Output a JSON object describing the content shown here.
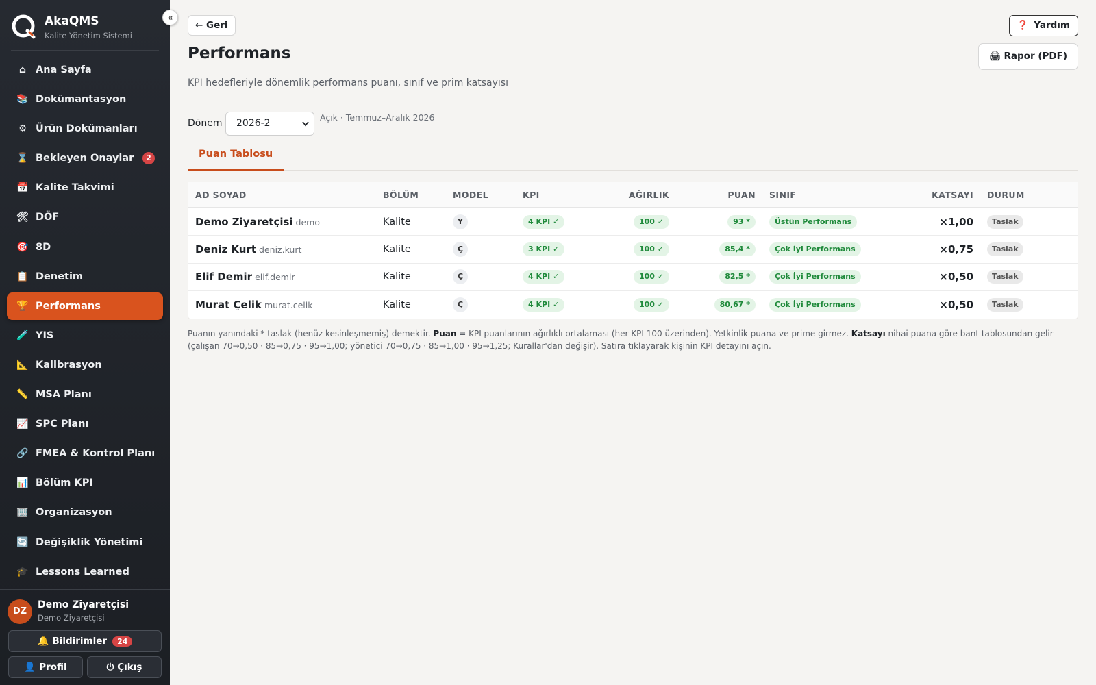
{
  "sidebar": {
    "brand": {
      "name": "AkaQMS",
      "subtitle": "Kalite Yönetim Sistemi"
    },
    "collapse_label": "«",
    "items": [
      {
        "label": "Ana Sayfa",
        "icon": "home-icon",
        "glyph": "⌂"
      },
      {
        "label": "Dokümantasyon",
        "icon": "books-icon",
        "glyph": "📚"
      },
      {
        "label": "Ürün Dokümanları",
        "icon": "gear-icon",
        "glyph": "⚙"
      },
      {
        "label": "Bekleyen Onaylar",
        "icon": "hourglass-icon",
        "glyph": "⌛",
        "badge": "2"
      },
      {
        "label": "Kalite Takvimi",
        "icon": "calendar-icon",
        "glyph": "📅"
      },
      {
        "label": "DÖF",
        "icon": "tools-icon",
        "glyph": "🛠"
      },
      {
        "label": "8D",
        "icon": "target-icon",
        "glyph": "🎯"
      },
      {
        "label": "Denetim",
        "icon": "clipboard-icon",
        "glyph": "📋"
      },
      {
        "label": "Performans",
        "icon": "trophy-icon",
        "glyph": "🏆",
        "active": true
      },
      {
        "label": "YIS",
        "icon": "test-tube-icon",
        "glyph": "🧪"
      },
      {
        "label": "Kalibrasyon",
        "icon": "triangle-ruler-icon",
        "glyph": "📐"
      },
      {
        "label": "MSA Planı",
        "icon": "ruler-icon",
        "glyph": "📏"
      },
      {
        "label": "SPC Planı",
        "icon": "chart-up-icon",
        "glyph": "📈"
      },
      {
        "label": "FMEA & Kontrol Planı",
        "icon": "link-icon",
        "glyph": "🔗"
      },
      {
        "label": "Bölüm KPI",
        "icon": "bar-chart-icon",
        "glyph": "📊"
      },
      {
        "label": "Organizasyon",
        "icon": "building-icon",
        "glyph": "🏢"
      },
      {
        "label": "Değişiklik Yönetimi",
        "icon": "cycle-icon",
        "glyph": "🔄"
      },
      {
        "label": "Lessons Learned",
        "icon": "graduation-cap-icon",
        "glyph": "🎓"
      }
    ],
    "user": {
      "initials": "DZ",
      "name": "Demo Ziyaretçisi",
      "role": "Demo Ziyaretçisi",
      "notifications_label": "Bildirimler",
      "notifications_glyph": "🔔",
      "notifications_count": "24",
      "profile_label": "Profil",
      "profile_glyph": "👤",
      "logout_label": "Çıkış",
      "logout_glyph": "⏻"
    }
  },
  "header": {
    "back_label": "← Geri",
    "help_glyph": "❓",
    "help_label": "Yardım",
    "title": "Performans",
    "pdf_label": "🖨 Rapor (PDF)",
    "description": "KPI hedefleriyle dönemlik performans puanı, sınıf ve prim katsayısı"
  },
  "period": {
    "label": "Dönem",
    "selected": "2026-2",
    "chevron": "⌄",
    "info": "Açık · Temmuz–Aralık 2026"
  },
  "tabs": [
    {
      "label": "Puan Tablosu",
      "active": true
    }
  ],
  "table": {
    "columns": [
      "AD SOYAD",
      "BÖLÜM",
      "MODEL",
      "KPI",
      "AĞIRLIK",
      "PUAN",
      "SINIF",
      "KATSAYI",
      "DURUM"
    ],
    "rows": [
      {
        "name": "Demo Ziyaretçisi",
        "username": "demo",
        "dept": "Kalite",
        "model": "Y",
        "kpi": "4 KPI ✓",
        "weight": "100 ✓",
        "score": "93 *",
        "class": "Üstün Performans",
        "coef": "×1,00",
        "status": "Taslak"
      },
      {
        "name": "Deniz Kurt",
        "username": "deniz.kurt",
        "dept": "Kalite",
        "model": "Ç",
        "kpi": "3 KPI ✓",
        "weight": "100 ✓",
        "score": "85,4 *",
        "class": "Çok İyi Performans",
        "coef": "×0,75",
        "status": "Taslak"
      },
      {
        "name": "Elif Demir",
        "username": "elif.demir",
        "dept": "Kalite",
        "model": "Ç",
        "kpi": "4 KPI ✓",
        "weight": "100 ✓",
        "score": "82,5 *",
        "class": "Çok İyi Performans",
        "coef": "×0,50",
        "status": "Taslak"
      },
      {
        "name": "Murat Çelik",
        "username": "murat.celik",
        "dept": "Kalite",
        "model": "Ç",
        "kpi": "4 KPI ✓",
        "weight": "100 ✓",
        "score": "80,67 *",
        "class": "Çok İyi Performans",
        "coef": "×0,50",
        "status": "Taslak"
      }
    ]
  },
  "footnote": {
    "part1": "Puanın yanındaki * taslak (henüz kesinleşmemiş) demektir. ",
    "bold1": "Puan",
    "part2": " = KPI puanlarının ağırlıklı ortalaması (her KPI 100 üzerinden). Yetkinlik puana ve prime girmez. ",
    "bold2": "Katsayı",
    "part3": " nihai puana göre bant tablosundan gelir (çalışan 70→0,50 · 85→0,75 · 95→1,00; yönetici 70→0,75 · 85→1,00 · 95→1,25; Kurallar'dan değişir). Satıra tıklayarak kişinin KPI detayını açın."
  },
  "colors": {
    "accent": "#d9531e",
    "sidebar_bg": "#262a31",
    "success": "#1f8a3b",
    "danger": "#d64545"
  }
}
